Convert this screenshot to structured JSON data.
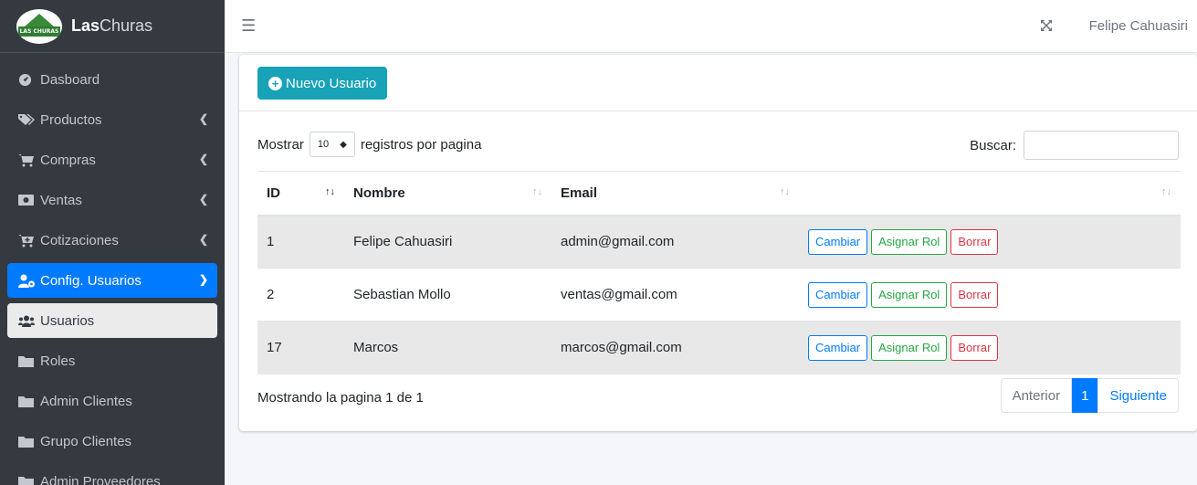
{
  "brand": {
    "logo_text": "LAS CHURAS",
    "name_bold": "Las",
    "name_rest": "Churas"
  },
  "sidebar": {
    "items": [
      {
        "label": "Dasboard",
        "icon": "dashboard-icon"
      },
      {
        "label": "Productos",
        "icon": "tags-icon"
      },
      {
        "label": "Compras",
        "icon": "cart-icon"
      },
      {
        "label": "Ventas",
        "icon": "money-icon"
      },
      {
        "label": "Cotizaciones",
        "icon": "cart-plus-icon"
      },
      {
        "label": "Config. Usuarios",
        "icon": "user-cog-icon"
      },
      {
        "label": "Usuarios",
        "icon": "users-icon"
      },
      {
        "label": "Roles",
        "icon": "folder-icon"
      },
      {
        "label": "Admin Clientes",
        "icon": "folder-icon"
      },
      {
        "label": "Grupo Clientes",
        "icon": "folder-icon"
      },
      {
        "label": "Admin Proveedores",
        "icon": "folder-icon"
      }
    ]
  },
  "topbar": {
    "user": "Felipe Cahuasiri"
  },
  "toolbar": {
    "new_user_label": "Nuevo Usuario"
  },
  "table_controls": {
    "show_label": "Mostrar",
    "page_size": "10",
    "per_page_label": "registros por pagina",
    "search_label": "Buscar:"
  },
  "table": {
    "headers": [
      "ID",
      "Nombre",
      "Email",
      ""
    ],
    "rows": [
      {
        "id": "1",
        "name": "Felipe Cahuasiri",
        "email": "admin@gmail.com"
      },
      {
        "id": "2",
        "name": "Sebastian Mollo",
        "email": "ventas@gmail.com"
      },
      {
        "id": "17",
        "name": "Marcos",
        "email": "marcos@gmail.com"
      }
    ],
    "actions": {
      "edit": "Cambiar",
      "assign": "Asignar Rol",
      "delete": "Borrar"
    }
  },
  "footer": {
    "info": "Mostrando la pagina 1 de 1",
    "prev": "Anterior",
    "current": "1",
    "next": "Siguiente"
  },
  "colors": {
    "accent": "#007bff",
    "info": "#17a2b8",
    "sidebar": "#343a40",
    "success": "#28a745",
    "danger": "#dc3545"
  }
}
